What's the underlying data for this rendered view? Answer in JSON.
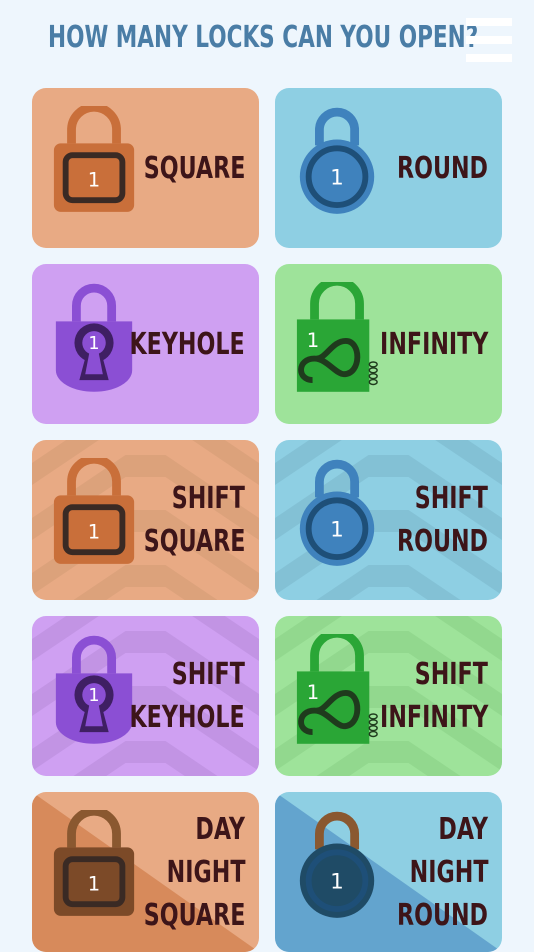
{
  "title": "HOW MANY LOCKS CAN YOU OPEN?",
  "menu_icon": "hamburger-menu-icon",
  "colors": {
    "background": "#eef6fd",
    "title": "#4a7da6",
    "label": "#3d1519",
    "square_card": "#e8aa84",
    "round_card": "#8ecfe3",
    "keyhole_card": "#cfa0f2",
    "infinity_card": "#9ee39a"
  },
  "locks": [
    {
      "label_lines": [
        "SQUARE"
      ],
      "lock_number": "1",
      "lock_icon": "square-lock-icon"
    },
    {
      "label_lines": [
        "ROUND"
      ],
      "lock_number": "1",
      "lock_icon": "round-lock-icon"
    },
    {
      "label_lines": [
        "KEYHOLE"
      ],
      "lock_number": "1",
      "lock_icon": "keyhole-lock-icon"
    },
    {
      "label_lines": [
        "INFINITY"
      ],
      "lock_number": "1",
      "lock_icon": "infinity-lock-icon"
    },
    {
      "label_lines": [
        "SHIFT",
        "SQUARE"
      ],
      "lock_number": "1",
      "lock_icon": "square-lock-icon"
    },
    {
      "label_lines": [
        "SHIFT",
        "ROUND"
      ],
      "lock_number": "1",
      "lock_icon": "round-lock-icon"
    },
    {
      "label_lines": [
        "SHIFT",
        "KEYHOLE"
      ],
      "lock_number": "1",
      "lock_icon": "keyhole-lock-icon"
    },
    {
      "label_lines": [
        "SHIFT",
        "INFINITY"
      ],
      "lock_number": "1",
      "lock_icon": "infinity-lock-icon"
    },
    {
      "label_lines": [
        "DAY",
        "NIGHT",
        "SQUARE"
      ],
      "lock_number": "1",
      "lock_icon": "square-lock-icon"
    },
    {
      "label_lines": [
        "DAY",
        "NIGHT",
        "ROUND"
      ],
      "lock_number": "1",
      "lock_icon": "round-lock-icon"
    }
  ]
}
